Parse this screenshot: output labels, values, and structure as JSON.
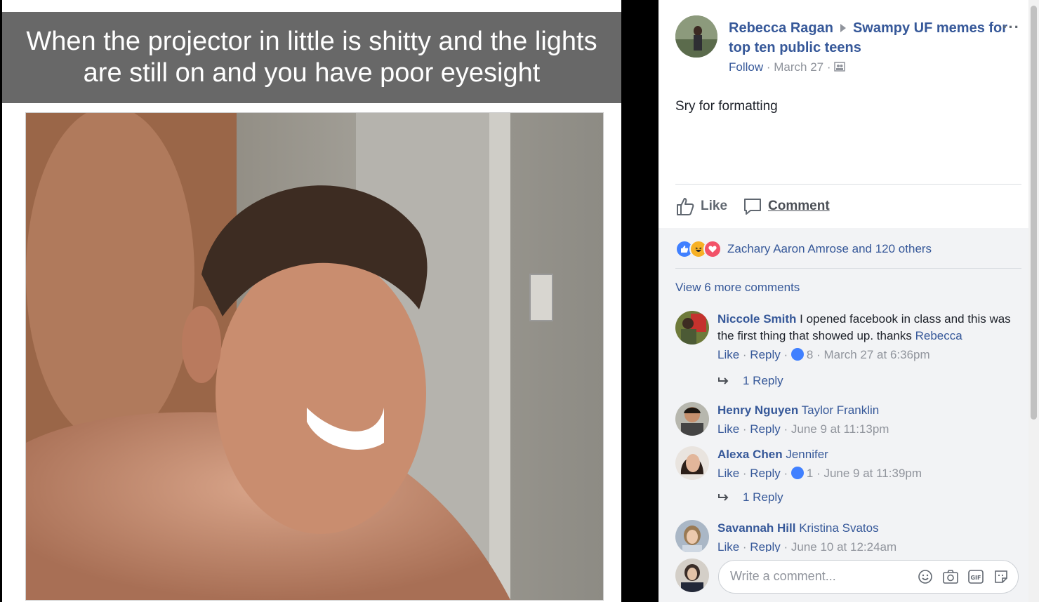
{
  "meme": {
    "caption_line1": "When the projector in little is shitty and the lights",
    "caption_line2": "are still on and you have poor eyesight"
  },
  "post": {
    "author": "Rebecca Ragan",
    "group": "Swampy UF memes for top ten public teens",
    "follow_label": "Follow",
    "date": "March 27",
    "privacy_icon": "group-audience-icon",
    "text": "Sry for formatting",
    "more_label": "···"
  },
  "actions": {
    "like_label": "Like",
    "comment_label": "Comment"
  },
  "reactions": {
    "summary": "Zachary Aaron Amrose and 120 others",
    "types": [
      "like",
      "haha",
      "love"
    ]
  },
  "comments": {
    "view_more": "View 6 more comments",
    "items": [
      {
        "author": "Niccole Smith",
        "text": "I opened facebook in class and this was the first thing that showed up. thanks",
        "tag": "Rebecca",
        "like": "Like",
        "reply": "Reply",
        "likes": "8",
        "time": "March 27 at 6:36pm",
        "replies": "1 Reply"
      },
      {
        "author": "Henry Nguyen",
        "tag": "Taylor Franklin",
        "like": "Like",
        "reply": "Reply",
        "time": "June 9 at 11:13pm"
      },
      {
        "author": "Alexa Chen",
        "tag": "Jennifer",
        "like": "Like",
        "reply": "Reply",
        "likes": "1",
        "time": "June 9 at 11:39pm",
        "replies": "1 Reply"
      },
      {
        "author": "Savannah Hill",
        "tag": "Kristina Svatos",
        "like": "Like",
        "reply": "Reply",
        "time": "June 10 at 12:24am"
      }
    ]
  },
  "composer": {
    "placeholder": "Write a comment...",
    "icons": [
      "emoji-icon",
      "camera-icon",
      "gif-icon",
      "sticker-icon"
    ]
  },
  "colors": {
    "link": "#365899",
    "meta": "#90949c",
    "like_blue": "#4080ff",
    "caption_bg": "#686868"
  }
}
